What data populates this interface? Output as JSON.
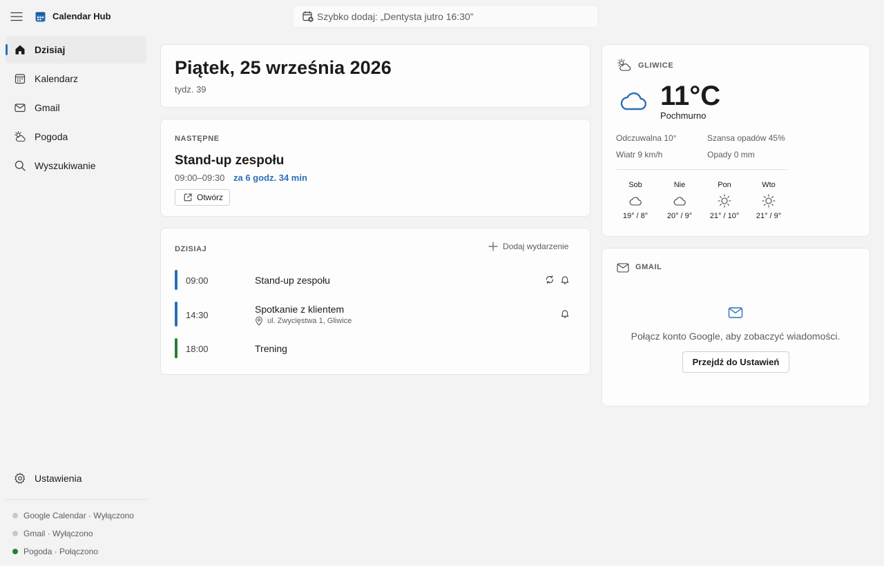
{
  "app": {
    "title": "Calendar Hub"
  },
  "quick_add": {
    "placeholder": "Szybko dodaj: „Dentysta jutro 16:30”"
  },
  "sidebar": {
    "items": [
      {
        "label": "Dzisiaj",
        "icon": "home-icon",
        "active": true
      },
      {
        "label": "Kalendarz",
        "icon": "calendar-icon"
      },
      {
        "label": "Gmail",
        "icon": "mail-icon"
      },
      {
        "label": "Pogoda",
        "icon": "weather-icon"
      },
      {
        "label": "Wyszukiwanie",
        "icon": "search-icon"
      }
    ],
    "settings_label": "Ustawienia",
    "statuses": [
      {
        "label": "Google Calendar · Wyłączono",
        "color": "#c8c8c8"
      },
      {
        "label": "Gmail · Wyłączono",
        "color": "#c8c8c8"
      },
      {
        "label": "Pogoda · Połączono",
        "color": "#2e7d32"
      }
    ]
  },
  "today_card": {
    "date": "Piątek, 25 września 2026",
    "week": "tydz. 39"
  },
  "next_card": {
    "label": "NASTĘPNE",
    "title": "Stand-up zespołu",
    "time": "09:00–09:30",
    "countdown": "za 6 godz. 34 min",
    "open_label": "Otwórz"
  },
  "agenda": {
    "label": "DZISIAJ",
    "add_label": "Dodaj wydarzenie",
    "events": [
      {
        "time": "09:00",
        "title": "Stand-up zespołu",
        "color": "#2b6fb6",
        "recurring": true,
        "reminder": true
      },
      {
        "time": "14:30",
        "title": "Spotkanie z klientem",
        "location": "ul. Zwycięstwa 1, Gliwice",
        "color": "#2b6fb6",
        "reminder": true
      },
      {
        "time": "18:00",
        "title": "Trening",
        "color": "#2e7d32"
      }
    ]
  },
  "weather": {
    "city": "GLIWICE",
    "temp": "11°C",
    "condition": "Pochmurno",
    "feels_like": "Odczuwalna 10°",
    "wind": "Wiatr 9 km/h",
    "rain_chance": "Szansa opadów 45%",
    "precip": "Opady 0 mm",
    "forecast": [
      {
        "day": "Sob",
        "icon": "cloud-icon",
        "temp": "19° / 8°"
      },
      {
        "day": "Nie",
        "icon": "cloud-icon",
        "temp": "20° / 9°"
      },
      {
        "day": "Pon",
        "icon": "sun-icon",
        "temp": "21° / 10°"
      },
      {
        "day": "Wto",
        "icon": "sun-icon",
        "temp": "21° / 9°"
      }
    ]
  },
  "gmail": {
    "title": "GMAIL",
    "message": "Połącz konto Google, aby zobaczyć wiadomości.",
    "button": "Przejdź do Ustawień"
  },
  "colors": {
    "accent": "#2b6fb6",
    "green": "#2e7d32"
  }
}
